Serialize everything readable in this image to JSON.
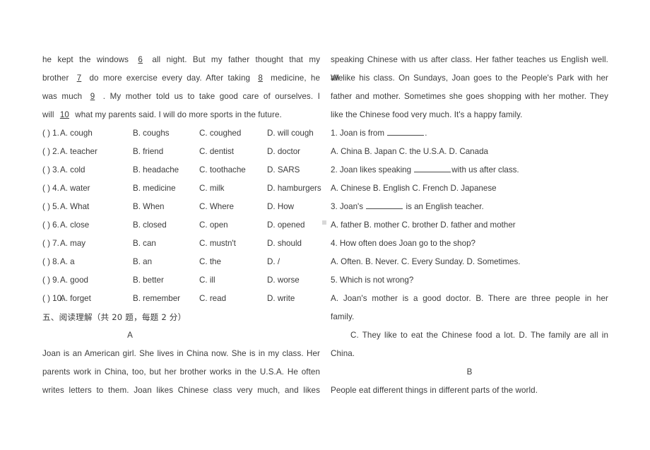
{
  "document": {
    "type": "english-exam-worksheet",
    "background_color": "#ffffff",
    "text_color": "#3b3b3b"
  },
  "left_column": {
    "cloze_passage": {
      "lines": [
        {
          "before": "he kept the windows",
          "blank": "6",
          "after": "all night. But my father thought that my"
        },
        {
          "before": "brother",
          "blank": "7",
          "after": "do more exercise every day. After taking",
          "blank2": "8",
          "after2": "medicine, he"
        },
        {
          "before": "was much",
          "blank": "9",
          "after": ". My mother told us to take good care of ourselves. I"
        },
        {
          "before": "will",
          "blank": "10",
          "after": "what my parents said. I will do more sports in the future."
        }
      ]
    },
    "choice_rows": [
      {
        "box": "(  ) 1.",
        "a": "A.   cough",
        "b": "B.   coughs",
        "c": "C.   coughed",
        "d": "D. will cough"
      },
      {
        "box": "(  ) 2.",
        "a": "A. teacher",
        "b": "B. friend",
        "c": "C. dentist",
        "d": "D. doctor"
      },
      {
        "box": "(  ) 3.",
        "a": "A. cold",
        "b": "B. headache",
        "c": "C. toothache",
        "d": "D. SARS"
      },
      {
        "box": "(  ) 4.",
        "a": "A. water",
        "b": "B. medicine",
        "c": "C. milk",
        "d": "D. hamburgers"
      },
      {
        "box": "(  ) 5.",
        "a": "A. What",
        "b": "B. When",
        "c": "C. Where",
        "d": "D. How"
      },
      {
        "box": "(  ) 6.",
        "a": "A. close",
        "b": "B. closed",
        "c": "C. open",
        "d": "D. opened"
      },
      {
        "box": "(  ) 7.",
        "a": "A. may",
        "b": "B. can",
        "c": "C. mustn't",
        "d": "D. should"
      },
      {
        "box": "(  ) 8.",
        "a": "A. a",
        "b": "B. an",
        "c": "C. the",
        "d": "D. /"
      },
      {
        "box": "(  ) 9.",
        "a": "A. good",
        "b": "B. better",
        "c": "C. ill",
        "d": "D. worse"
      },
      {
        "box": "(  ) 10.",
        "a": "A. forget",
        "b": "B. remember",
        "c": "C. read",
        "d": "D. write"
      }
    ],
    "section_heading": "五、阅读理解（共 20 题，每题 2 分）",
    "passage_a_label": "A",
    "passage_a_lines": [
      "Joan is an American girl. She lives in China now. She is in my class. Her",
      "parents work in China, too, but her brother works in the U.S.A. He often",
      "writes letters to them. Joan likes Chinese class very much, and likes"
    ]
  },
  "right_column": {
    "passage_a_cont_lines": [
      "speaking Chinese with us after class. Her father teaches us English well. We",
      "all like his class. On Sundays, Joan goes to the People's Park with her",
      "father and mother. Sometimes she goes shopping with her mother. They",
      "like the Chinese food very much. It's a happy family."
    ],
    "questions": [
      {
        "kind": "stem_fill",
        "pre": "1. Joan is from ",
        "post": "."
      },
      {
        "kind": "options",
        "text": "A. China B. Japan  C. the U.S.A. D. Canada"
      },
      {
        "kind": "stem_fill",
        "pre": "2. Joan likes speaking ",
        "post": "with us after class."
      },
      {
        "kind": "options",
        "text": "A. Chinese B. English  C. French D. Japanese"
      },
      {
        "kind": "stem_fill",
        "pre": "3. Joan's ",
        "post": " is an English teacher."
      },
      {
        "kind": "options",
        "text": "A. father B. mother  C. brother D. father and mother"
      },
      {
        "kind": "stem",
        "text": "4. How often does Joan go to the shop?"
      },
      {
        "kind": "options",
        "text": "A. Often. B. Never.  C. Every Sunday. D. Sometimes."
      },
      {
        "kind": "stem",
        "text": "5. Which is not wrong?"
      }
    ],
    "answer_block_lines": [
      "A. Joan's mother is a good doctor.  B. There are three people in her",
      "family.",
      "C. They like to eat the Chinese food a lot.  D. The family are all in",
      "China."
    ],
    "passage_b_label": "B",
    "passage_b_lines": [
      "People eat different things in different parts of the world."
    ]
  }
}
